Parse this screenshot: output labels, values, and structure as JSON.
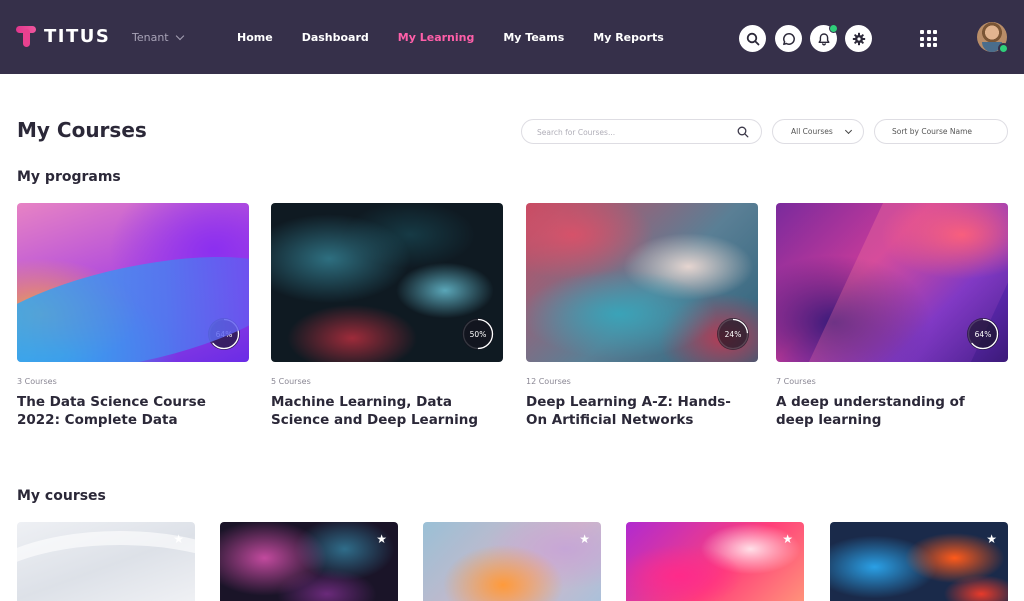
{
  "app": {
    "logo_text": "TITUS",
    "tenant_label": "Tenant"
  },
  "nav": {
    "items": [
      {
        "label": "Home",
        "active": false
      },
      {
        "label": "Dashboard",
        "active": false
      },
      {
        "label": "My Learning",
        "active": true
      },
      {
        "label": "My Teams",
        "active": false
      },
      {
        "label": "My Reports",
        "active": false
      }
    ]
  },
  "header_icons": [
    "search-icon",
    "chat-icon",
    "bell-icon",
    "gear-icon",
    "apps-grid-icon"
  ],
  "colors": {
    "topbar": "#36304a",
    "accent": "#ff5fa9",
    "online_status": "#2fcf7a",
    "notification_dot": "#2fcf7a"
  },
  "page": {
    "title": "My Courses"
  },
  "search": {
    "placeholder": "Search for Courses...",
    "value": ""
  },
  "filter": {
    "selected": "All Courses"
  },
  "sort": {
    "label": "Sort by Course Name"
  },
  "programs": {
    "heading": "My programs",
    "items": [
      {
        "count": "3 Courses",
        "title": "The Data Science Course 2022: Complete Data",
        "progress_label": "64%",
        "progress": 64
      },
      {
        "count": "5 Courses",
        "title": "Machine Learning, Data Science and Deep Learning",
        "progress_label": "50%",
        "progress": 50
      },
      {
        "count": "12 Courses",
        "title": "Deep Learning A-Z: Hands-On Artificial Networks",
        "progress_label": "24%",
        "progress": 24
      },
      {
        "count": "7 Courses",
        "title": "A deep understanding of deep learning",
        "progress_label": "64%",
        "progress": 64
      }
    ]
  },
  "courses": {
    "heading": "My courses",
    "items": [
      {
        "star": "★"
      },
      {
        "star": "★"
      },
      {
        "star": "★"
      },
      {
        "star": "★"
      },
      {
        "star": "★"
      }
    ]
  }
}
